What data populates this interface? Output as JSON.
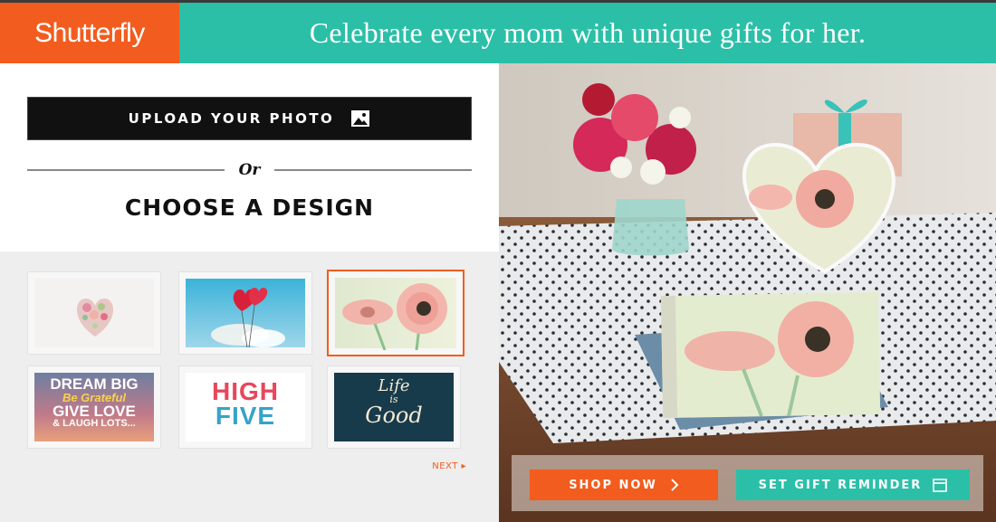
{
  "header": {
    "logo": "Shutterfly",
    "tagline": "Celebrate every mom with unique gifts for her."
  },
  "left": {
    "upload_label": "UPLOAD YOUR PHOTO",
    "or_label": "Or",
    "choose_title": "CHOOSE A DESIGN",
    "next_label": "NEXT ▸",
    "designs": [
      {
        "name": "floral heart",
        "selected": false
      },
      {
        "name": "red balloons",
        "selected": false
      },
      {
        "name": "pink gerbera daisies",
        "selected": true
      },
      {
        "name": "dream big typography",
        "selected": false,
        "text": [
          "DREAM BIG",
          "Be Grateful",
          "GIVE LOVE",
          "& LAUGH LOTS..."
        ]
      },
      {
        "name": "high five typography",
        "selected": false,
        "text": [
          "HIGH",
          "FIVE"
        ]
      },
      {
        "name": "life is good typography",
        "selected": false,
        "text": [
          "Life",
          "is",
          "Good"
        ]
      }
    ]
  },
  "hero": {
    "shop_now_label": "SHOP NOW",
    "gift_reminder_label": "SET GIFT REMINDER"
  },
  "colors": {
    "brand_orange": "#f25c1e",
    "teal": "#2bbfa8",
    "dark": "#111111"
  }
}
